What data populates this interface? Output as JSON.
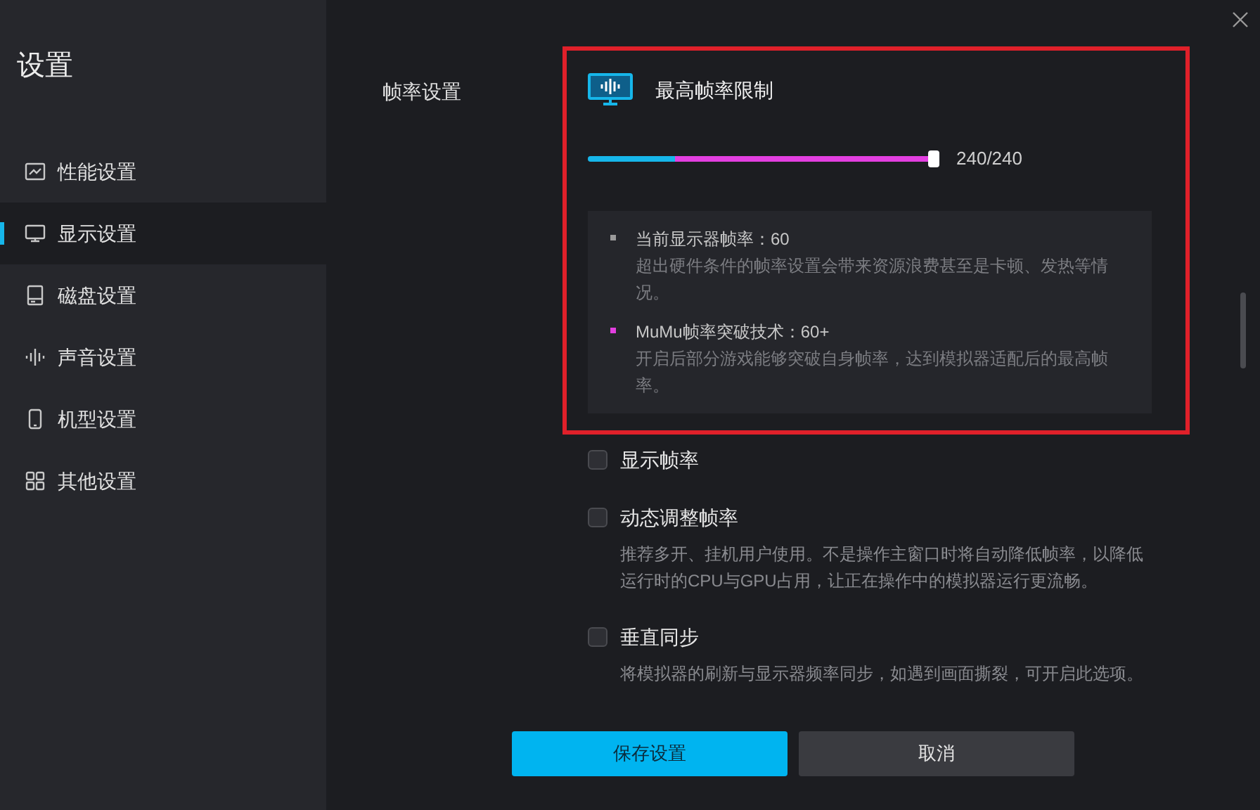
{
  "sidebar": {
    "title": "设置",
    "items": [
      {
        "label": "性能设置",
        "kind": "chart",
        "selected": false
      },
      {
        "label": "显示设置",
        "kind": "monitor",
        "selected": true
      },
      {
        "label": "磁盘设置",
        "kind": "disk",
        "selected": false
      },
      {
        "label": "声音设置",
        "kind": "sound",
        "selected": false
      },
      {
        "label": "机型设置",
        "kind": "phone",
        "selected": false
      },
      {
        "label": "其他设置",
        "kind": "grid",
        "selected": false
      }
    ]
  },
  "section_label": "帧率设置",
  "frame_limit": {
    "title": "最高帧率限制",
    "slider": {
      "level": 1,
      "reading": "240/240",
      "segments": [
        {
          "color": "#16b6ea",
          "level": 0.25
        },
        {
          "color": "#e33fe0",
          "level": 0.75
        }
      ]
    },
    "notes": [
      {
        "color": "#9a9a9a",
        "heading": "当前显示器帧率：60",
        "text": "超出硬件条件的帧率设置会带来资源浪费甚至是卡顿、发热等情况。"
      },
      {
        "color": "#e33fe0",
        "heading": "MuMu帧率突破技术：60+",
        "text": "开启后部分游戏能够突破自身帧率，达到模拟器适配后的最高帧率。"
      }
    ]
  },
  "options": [
    {
      "label": "显示帧率",
      "checked": false
    },
    {
      "label": "动态调整帧率",
      "checked": false,
      "description": "推荐多开、挂机用户使用。不是操作主窗口时将自动降低帧率，以降低运行时的CPU与GPU占用，让正在操作中的模拟器运行更流畅。"
    },
    {
      "label": "垂直同步",
      "checked": false,
      "description": "将模拟器的刷新与显示器频率同步，如遇到画面撕裂，可开启此选项。"
    }
  ],
  "buttons": {
    "save": "保存设置",
    "cancel": "取消"
  }
}
